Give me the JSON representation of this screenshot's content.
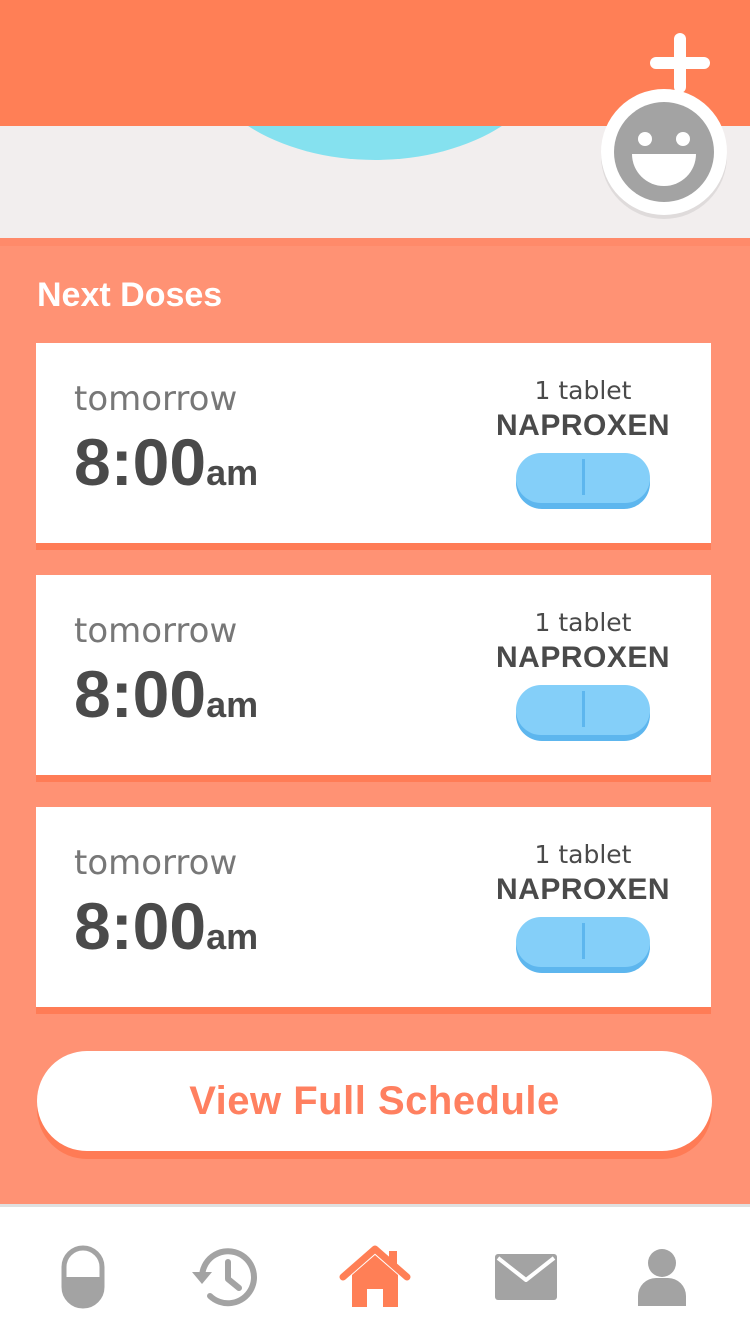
{
  "header": {
    "add_icon": "plus-icon",
    "color": "#ff7f56"
  },
  "hero": {
    "avatar_icon": "smiley-face-icon"
  },
  "next_doses": {
    "title": "Next Doses",
    "items": [
      {
        "when": "tomorrow",
        "time": "8:00",
        "ampm": "am",
        "quantity": "1 tablet",
        "medication": "NAPROXEN",
        "pill_icon": "pill-icon",
        "pill_color": "#84cff9"
      },
      {
        "when": "tomorrow",
        "time": "8:00",
        "ampm": "am",
        "quantity": "1 tablet",
        "medication": "NAPROXEN",
        "pill_icon": "pill-icon",
        "pill_color": "#84cff9"
      },
      {
        "when": "tomorrow",
        "time": "8:00",
        "ampm": "am",
        "quantity": "1 tablet",
        "medication": "NAPROXEN",
        "pill_icon": "pill-icon",
        "pill_color": "#84cff9"
      }
    ]
  },
  "schedule_button": {
    "label": "View Full Schedule"
  },
  "tabbar": {
    "active_color": "#ff7f56",
    "inactive_color": "#a3a3a3",
    "tabs": [
      {
        "icon": "capsule-icon",
        "active": false
      },
      {
        "icon": "history-icon",
        "active": false
      },
      {
        "icon": "home-icon",
        "active": true
      },
      {
        "icon": "mail-icon",
        "active": false
      },
      {
        "icon": "profile-icon",
        "active": false
      }
    ]
  }
}
